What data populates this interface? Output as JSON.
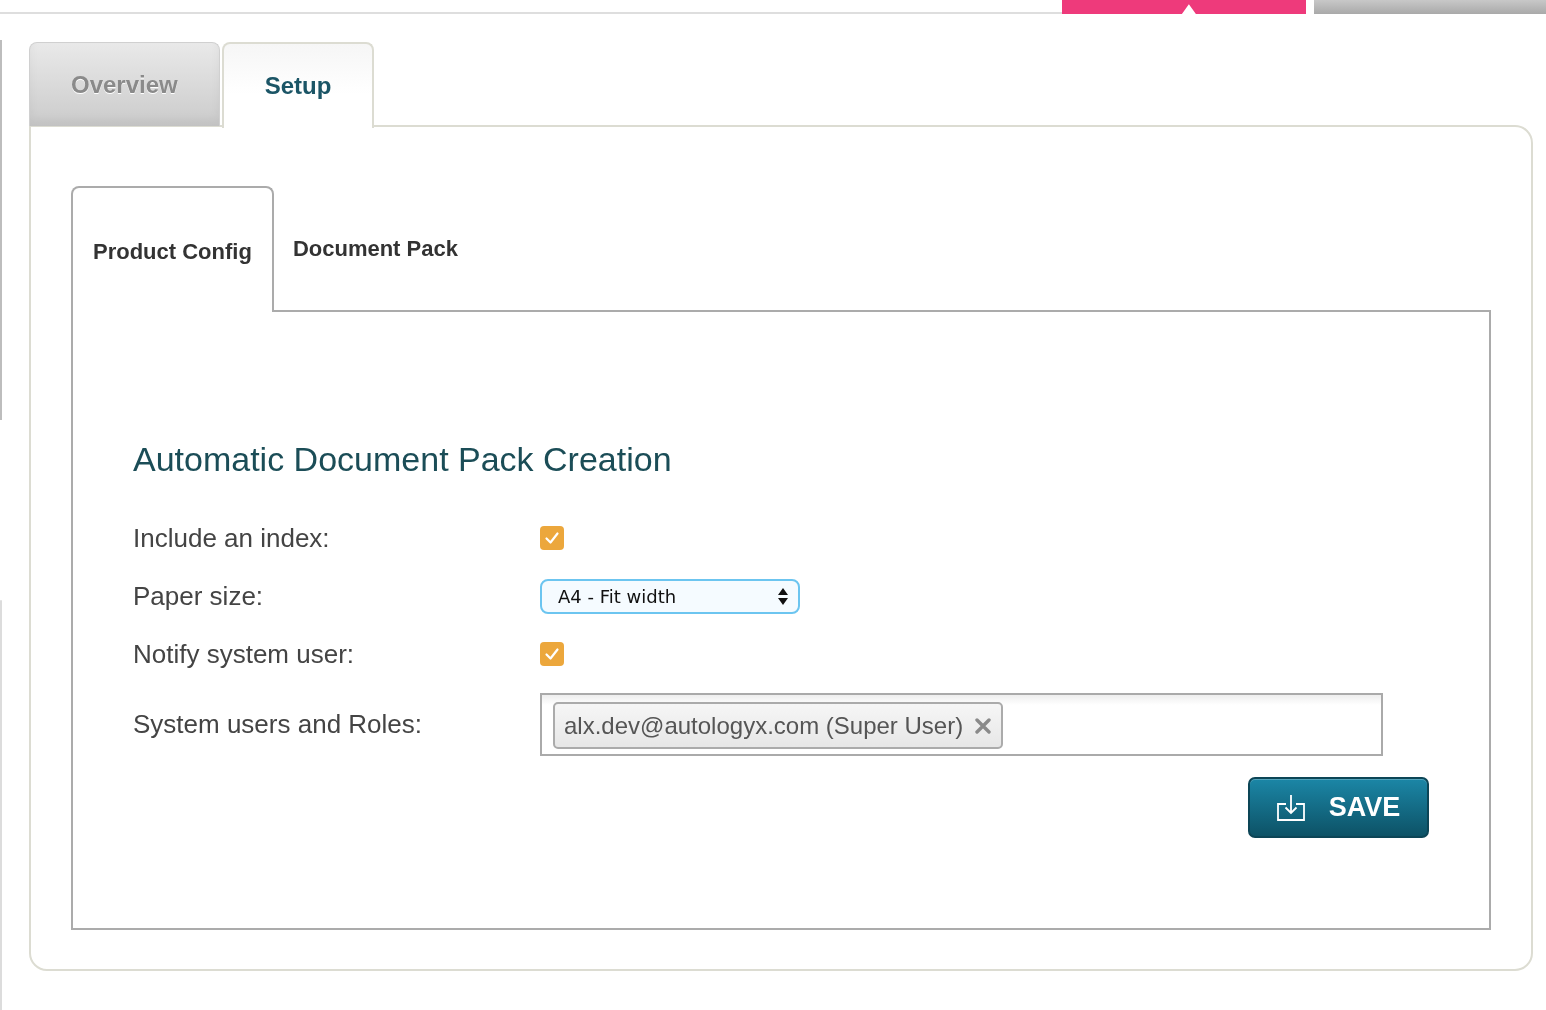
{
  "top_nav": {
    "items": [
      {
        "selected": true
      },
      {
        "selected": false
      }
    ]
  },
  "tabs": [
    {
      "label": "Overview",
      "selected": false
    },
    {
      "label": "Setup",
      "selected": true
    }
  ],
  "setup": {
    "tabs": [
      {
        "label": "Product Config",
        "selected": true
      },
      {
        "label": "Document Pack",
        "selected": false
      }
    ],
    "section_title": "Automatic Document Pack Creation",
    "fields": [
      {
        "kind": "checkbox",
        "label": "Include an index:",
        "checked": true
      },
      {
        "kind": "select",
        "label": "Paper size:",
        "value": "A4 - Fit width"
      },
      {
        "kind": "checkbox",
        "label": "Notify system user:",
        "checked": true
      },
      {
        "kind": "tags",
        "label": "System users and Roles:",
        "tags": [
          {
            "label": "alx.dev@autologyx.com (Super User)"
          }
        ]
      }
    ],
    "save_button": {
      "label": "SAVE"
    }
  }
}
